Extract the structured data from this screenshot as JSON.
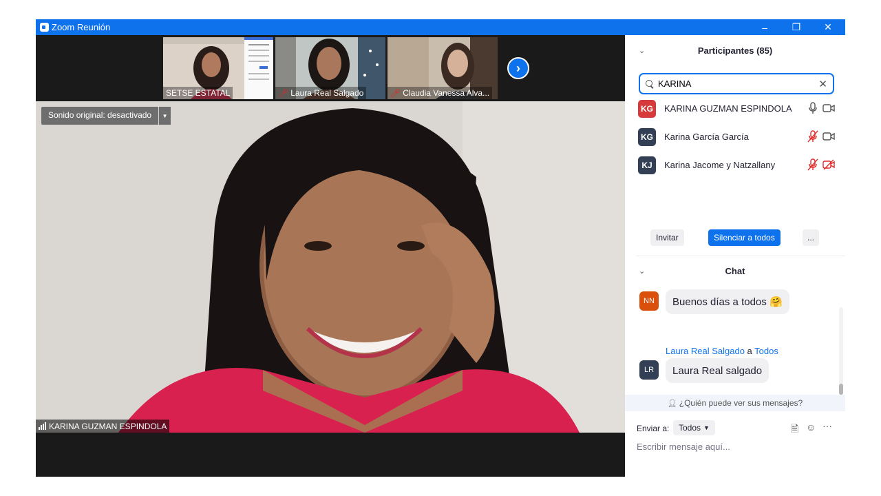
{
  "window": {
    "title": "Zoom Reunión"
  },
  "gallery": {
    "thumbnails": [
      {
        "name": "SETSE ESTATAL",
        "muted": false
      },
      {
        "name": "Laura Real Salgado",
        "muted": true
      },
      {
        "name": "Claudia Vanessa Alva...",
        "muted": true
      }
    ],
    "next_icon": "chevron-right-icon"
  },
  "main_video": {
    "original_sound_label": "Sonido original: desactivado",
    "speaker_name": "KARINA GUZMAN ESPINDOLA"
  },
  "participants": {
    "header": "Participantes (85)",
    "search_value": "KARINA",
    "list": [
      {
        "initials": "KG",
        "name": "KARINA GUZMAN ESPINDOLA",
        "avatar_color": "#d63a3a",
        "mic": "on",
        "video": "on"
      },
      {
        "initials": "KG",
        "name": "Karina García García",
        "avatar_color": "#333f55",
        "mic": "muted",
        "video": "on"
      },
      {
        "initials": "KJ",
        "name": "Karina Jacome y Natzallany",
        "avatar_color": "#333f55",
        "mic": "muted",
        "video": "off"
      }
    ],
    "invite_label": "Invitar",
    "mute_all_label": "Silenciar a todos",
    "more_label": "..."
  },
  "chat": {
    "header": "Chat",
    "messages": [
      {
        "initials": "NN",
        "avatar_color": "#d94f0b",
        "text": "Buenos días a todos",
        "emoji": "🤗"
      },
      {
        "sender": "Laura Real Salgado",
        "connector": "a",
        "recipient": "Todos",
        "initials": "LR",
        "avatar_color": "#333f55",
        "text": "Laura Real salgado"
      }
    ],
    "privacy_text": "¿Quién puede ver sus mensajes?",
    "send_to_label": "Enviar a:",
    "send_to_value": "Todos",
    "more_label": "···",
    "input_placeholder": "Escribir mensaje aquí..."
  },
  "colors": {
    "zoom_blue": "#0e72ed",
    "muted_red": "#e02828"
  }
}
